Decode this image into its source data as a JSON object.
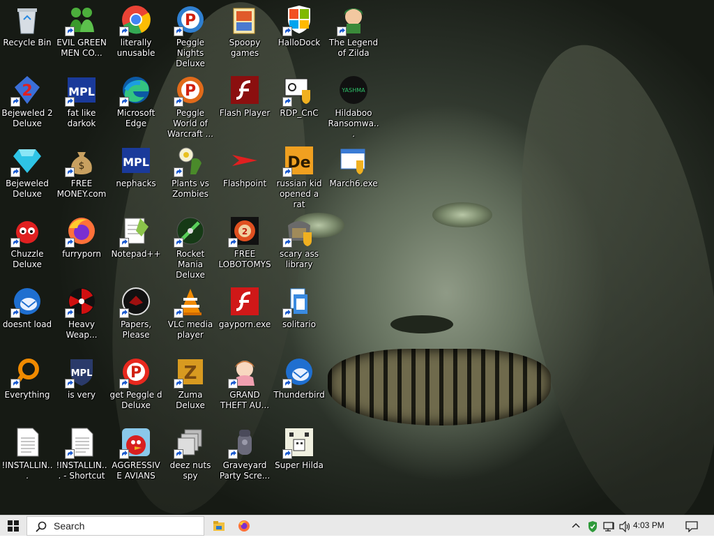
{
  "desktop": {
    "icons": [
      {
        "label": "Recycle Bin",
        "icon": "recycle-bin-icon",
        "shortcut": false,
        "color": "#d7dde4"
      },
      {
        "label": "EVIL GREEN MEN CO...",
        "icon": "green-men-icon",
        "shortcut": true,
        "color": "#4cae3c"
      },
      {
        "label": "literally unusable",
        "icon": "chrome-icon",
        "shortcut": true,
        "color": "#ea4335"
      },
      {
        "label": "Peggle Nights Deluxe",
        "icon": "peggle-nights-icon",
        "shortcut": true,
        "color": "#2f7fd0"
      },
      {
        "label": "Spoopy games",
        "icon": "folder-icon",
        "shortcut": false,
        "color": "#e8b84a"
      },
      {
        "label": "HalloDock",
        "icon": "windows-shield-icon",
        "shortcut": true,
        "color": "#f25022"
      },
      {
        "label": "The Legend of Zilda",
        "icon": "zilda-icon",
        "shortcut": true,
        "color": "#3a8a3a"
      },
      {
        "label": "Bejeweled 2 Deluxe",
        "icon": "bejeweled2-icon",
        "shortcut": true,
        "color": "#3b6fd8"
      },
      {
        "label": "fat like darkok",
        "icon": "mpl-icon",
        "shortcut": true,
        "color": "#1a3a9a"
      },
      {
        "label": "Microsoft Edge",
        "icon": "edge-icon",
        "shortcut": true,
        "color": "#1b8bd6"
      },
      {
        "label": "Peggle World of Warcraft ...",
        "icon": "peggle-wow-icon",
        "shortcut": true,
        "color": "#e06a1a"
      },
      {
        "label": "Flash Player",
        "icon": "flash-icon",
        "shortcut": false,
        "color": "#8b0f0f"
      },
      {
        "label": "RDP_CnC",
        "icon": "rdp-icon",
        "shortcut": true,
        "color": "#222222"
      },
      {
        "label": "Hildaboo Ransomwa...",
        "icon": "yashma-icon",
        "shortcut": false,
        "color": "#111111"
      },
      {
        "label": "Bejeweled Deluxe",
        "icon": "bejeweled-icon",
        "shortcut": true,
        "color": "#2ec4e6"
      },
      {
        "label": "FREE MONEY.com",
        "icon": "money-bag-icon",
        "shortcut": true,
        "color": "#b08a4a"
      },
      {
        "label": "nephacks",
        "icon": "mpl-icon",
        "shortcut": false,
        "color": "#1a3a9a"
      },
      {
        "label": "Plants vs Zombies",
        "icon": "pvz-icon",
        "shortcut": true,
        "color": "#f4f0d0"
      },
      {
        "label": "Flashpoint",
        "icon": "flashpoint-icon",
        "shortcut": false,
        "color": "#e02020"
      },
      {
        "label": "russian kid opened a rat",
        "icon": "de-icon",
        "shortcut": true,
        "color": "#f0a020"
      },
      {
        "label": "March6.exe",
        "icon": "installer-icon",
        "shortcut": false,
        "color": "#3a7bd5"
      },
      {
        "label": "Chuzzle Deluxe",
        "icon": "chuzzle-icon",
        "shortcut": true,
        "color": "#e02020"
      },
      {
        "label": "furryporn",
        "icon": "firefox-icon",
        "shortcut": true,
        "color": "#ff7139"
      },
      {
        "label": "Notepad++",
        "icon": "notepadpp-icon",
        "shortcut": true,
        "color": "#8bc34a"
      },
      {
        "label": "Rocket Mania Deluxe",
        "icon": "rocket-mania-icon",
        "shortcut": true,
        "color": "#2a6a2a"
      },
      {
        "label": "FREE LOBOTOMYS",
        "icon": "lobotomy-icon",
        "shortcut": true,
        "color": "#e05020"
      },
      {
        "label": "scary ass library",
        "icon": "library-icon",
        "shortcut": true,
        "color": "#6a6a6a"
      },
      {
        "label": "doesnt load",
        "icon": "thunderbird-icon",
        "shortcut": true,
        "color": "#1f6fd0"
      },
      {
        "label": "Heavy Weap...",
        "icon": "heavy-weapon-icon",
        "shortcut": true,
        "color": "#d01010"
      },
      {
        "label": "Papers, Please",
        "icon": "papers-please-icon",
        "shortcut": true,
        "color": "#111111"
      },
      {
        "label": "VLC media player",
        "icon": "vlc-icon",
        "shortcut": true,
        "color": "#f08a00"
      },
      {
        "label": "gayporn.exe",
        "icon": "flash-icon",
        "shortcut": false,
        "color": "#d01818"
      },
      {
        "label": "solitario",
        "icon": "solitaire-icon",
        "shortcut": true,
        "color": "#3a8ae0"
      },
      {
        "label": "Everything",
        "icon": "everything-icon",
        "shortcut": true,
        "color": "#f08a00"
      },
      {
        "label": "is very",
        "icon": "mpl-shield-icon",
        "shortcut": true,
        "color": "#2a3a6a"
      },
      {
        "label": "get Peggle d Deluxe",
        "icon": "peggle-icon",
        "shortcut": true,
        "color": "#e8281e"
      },
      {
        "label": "Zuma Deluxe",
        "icon": "zuma-icon",
        "shortcut": true,
        "color": "#d89a20"
      },
      {
        "label": "GRAND THEFT AU...",
        "icon": "anime-girl-icon",
        "shortcut": true,
        "color": "#f0a0b0"
      },
      {
        "label": "Thunderbird",
        "icon": "thunderbird-icon",
        "shortcut": true,
        "color": "#1f6fd0"
      },
      {
        "label": "!INSTALLIN...",
        "icon": "text-file-icon",
        "shortcut": false,
        "color": "#ffffff"
      },
      {
        "label": "!INSTALLIN... - Shortcut",
        "icon": "text-file-icon",
        "shortcut": true,
        "color": "#ffffff"
      },
      {
        "label": "AGGRESSIVE AVIANS",
        "icon": "angry-bird-icon",
        "shortcut": true,
        "color": "#d82020"
      },
      {
        "label": "deez nuts spy",
        "icon": "copy-icon",
        "shortcut": true,
        "color": "#9a9a9a"
      },
      {
        "label": "Graveyard Party Scre...",
        "icon": "graveyard-icon",
        "shortcut": true,
        "color": "#4a4a5a"
      },
      {
        "label": "Super Hilda",
        "icon": "super-hilda-icon",
        "shortcut": true,
        "color": "#f0f0e0"
      }
    ]
  },
  "taskbar": {
    "search_placeholder": "Search",
    "pinned": [
      {
        "name": "file-explorer-icon",
        "color": "#f0c040"
      },
      {
        "name": "firefox-icon",
        "color": "#ff7139"
      }
    ],
    "tray": {
      "clock": "4:03 PM"
    }
  }
}
